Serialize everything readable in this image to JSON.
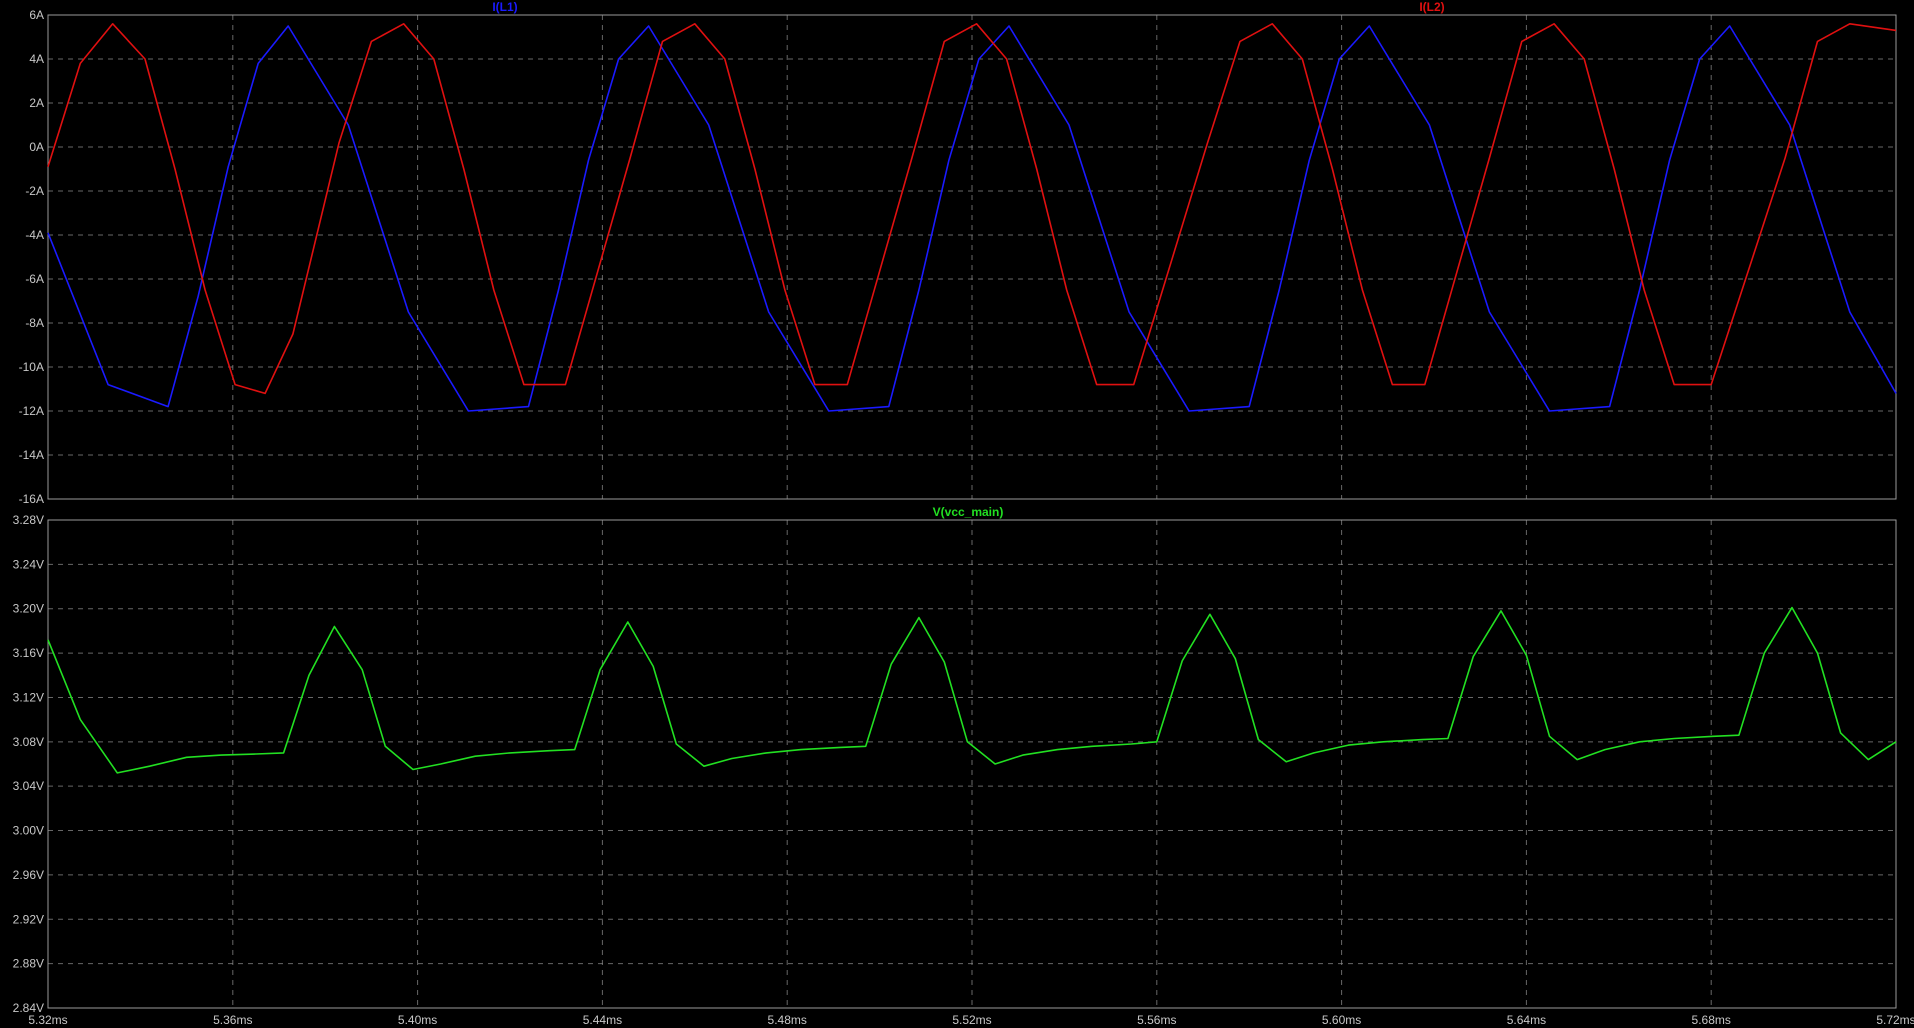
{
  "chart_data": [
    {
      "type": "line",
      "title": "",
      "xlabel": "",
      "ylabel": "",
      "xlim": [
        5.32,
        5.72
      ],
      "ylim": [
        -16,
        6
      ],
      "x_unit": "ms",
      "grid": true,
      "legend": "top",
      "y_ticks": [
        "6A",
        "4A",
        "2A",
        "0A",
        "-2A",
        "-4A",
        "-6A",
        "-8A",
        "-10A",
        "-12A",
        "-14A",
        "-16A"
      ],
      "series": [
        {
          "name": "I(L1)",
          "color": "#1a1aff",
          "x": [
            5.32,
            5.333,
            5.346,
            5.3525,
            5.359,
            5.3655,
            5.372,
            5.385,
            5.398,
            5.411,
            5.424,
            5.4305,
            5.437,
            5.4435,
            5.45,
            5.463,
            5.476,
            5.489,
            5.502,
            5.5085,
            5.515,
            5.5215,
            5.528,
            5.541,
            5.554,
            5.567,
            5.58,
            5.5865,
            5.593,
            5.5995,
            5.606,
            5.619,
            5.632,
            5.645,
            5.658,
            5.6645,
            5.671,
            5.6775,
            5.684,
            5.697,
            5.71,
            5.72
          ],
          "y": [
            -3.9,
            -10.8,
            -11.8,
            -6.8,
            -0.9,
            3.8,
            5.5,
            1.0,
            -7.5,
            -12.0,
            -11.8,
            -6.5,
            -0.6,
            4.0,
            5.5,
            1.0,
            -7.5,
            -12.0,
            -11.8,
            -6.5,
            -0.6,
            4.0,
            5.5,
            1.0,
            -7.5,
            -12.0,
            -11.8,
            -6.5,
            -0.6,
            4.0,
            5.5,
            1.0,
            -7.5,
            -12.0,
            -11.8,
            -6.5,
            -0.6,
            4.0,
            5.5,
            1.0,
            -7.5,
            -11.2
          ]
        },
        {
          "name": "I(L2)",
          "color": "#e01010",
          "x": [
            5.32,
            5.327,
            5.334,
            5.341,
            5.3475,
            5.354,
            5.3605,
            5.367,
            5.373,
            5.383,
            5.39,
            5.397,
            5.4035,
            5.41,
            5.4165,
            5.423,
            5.432,
            5.446,
            5.453,
            5.46,
            5.4665,
            5.473,
            5.4795,
            5.486,
            5.493,
            5.507,
            5.514,
            5.521,
            5.5275,
            5.534,
            5.5405,
            5.547,
            5.555,
            5.571,
            5.578,
            5.585,
            5.5915,
            5.598,
            5.6045,
            5.611,
            5.618,
            5.632,
            5.639,
            5.646,
            5.6525,
            5.659,
            5.6655,
            5.672,
            5.68,
            5.696,
            5.703,
            5.71,
            5.72
          ],
          "y": [
            -0.9,
            3.8,
            5.6,
            4.0,
            -1.0,
            -6.5,
            -10.8,
            -11.2,
            -8.5,
            0.2,
            4.8,
            5.6,
            4.0,
            -1.0,
            -6.5,
            -10.8,
            -10.8,
            -0.5,
            4.8,
            5.6,
            4.0,
            -1.0,
            -6.5,
            -10.8,
            -10.8,
            -0.5,
            4.8,
            5.6,
            4.0,
            -1.0,
            -6.5,
            -10.8,
            -10.8,
            0.2,
            4.8,
            5.6,
            4.0,
            -1.0,
            -6.5,
            -10.8,
            -10.8,
            -0.5,
            4.8,
            5.6,
            4.0,
            -1.0,
            -6.5,
            -10.8,
            -10.8,
            -0.5,
            4.8,
            5.6,
            5.3
          ]
        }
      ]
    },
    {
      "type": "line",
      "title": "",
      "xlabel": "",
      "ylabel": "",
      "xlim": [
        5.32,
        5.72
      ],
      "ylim": [
        2.84,
        3.28
      ],
      "x_unit": "ms",
      "grid": true,
      "legend": "top",
      "y_ticks": [
        "3.28V",
        "3.24V",
        "3.20V",
        "3.16V",
        "3.12V",
        "3.08V",
        "3.04V",
        "3.00V",
        "2.96V",
        "2.92V",
        "2.88V",
        "2.84V"
      ],
      "x_ticks": [
        "5.32ms",
        "5.36ms",
        "5.40ms",
        "5.44ms",
        "5.48ms",
        "5.52ms",
        "5.56ms",
        "5.60ms",
        "5.64ms",
        "5.68ms",
        "5.72ms"
      ],
      "series": [
        {
          "name": "V(vcc_main)",
          "color": "#22e022",
          "x": [
            5.32,
            5.327,
            5.335,
            5.342,
            5.35,
            5.3575,
            5.365,
            5.371,
            5.3765,
            5.382,
            5.388,
            5.393,
            5.399,
            5.405,
            5.4125,
            5.42,
            5.4285,
            5.434,
            5.4395,
            5.4455,
            5.451,
            5.456,
            5.462,
            5.468,
            5.4755,
            5.483,
            5.4915,
            5.497,
            5.5025,
            5.5085,
            5.514,
            5.519,
            5.525,
            5.531,
            5.5385,
            5.546,
            5.5545,
            5.56,
            5.5655,
            5.5715,
            5.577,
            5.582,
            5.588,
            5.594,
            5.6015,
            5.609,
            5.6175,
            5.623,
            5.6285,
            5.6345,
            5.64,
            5.645,
            5.651,
            5.657,
            5.6645,
            5.672,
            5.6805,
            5.686,
            5.6915,
            5.6975,
            5.703,
            5.708,
            5.714,
            5.72
          ],
          "y": [
            3.172,
            3.1,
            3.052,
            3.058,
            3.066,
            3.068,
            3.069,
            3.07,
            3.14,
            3.184,
            3.145,
            3.076,
            3.055,
            3.06,
            3.067,
            3.07,
            3.072,
            3.073,
            3.145,
            3.188,
            3.148,
            3.078,
            3.058,
            3.065,
            3.07,
            3.073,
            3.075,
            3.076,
            3.15,
            3.192,
            3.152,
            3.08,
            3.06,
            3.068,
            3.073,
            3.076,
            3.078,
            3.08,
            3.153,
            3.195,
            3.155,
            3.082,
            3.062,
            3.07,
            3.077,
            3.08,
            3.082,
            3.083,
            3.157,
            3.198,
            3.158,
            3.085,
            3.064,
            3.073,
            3.08,
            3.083,
            3.085,
            3.086,
            3.16,
            3.201,
            3.16,
            3.088,
            3.064,
            3.08
          ]
        }
      ]
    }
  ]
}
